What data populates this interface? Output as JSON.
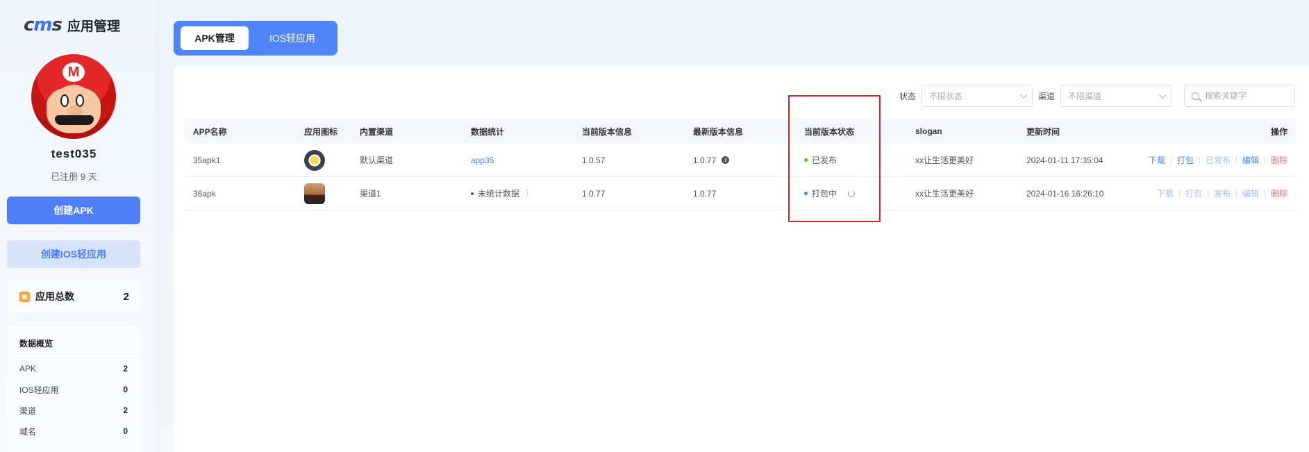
{
  "brand": {
    "logo": "cms",
    "title": "应用管理"
  },
  "user": {
    "name": "test035",
    "registered": "已注册 9 天"
  },
  "sidebar": {
    "create_apk": "创建APK",
    "create_ios": "创建IOS轻应用",
    "total_label": "应用总数",
    "total_value": "2",
    "overview_title": "数据概览",
    "overview": [
      {
        "label": "APK",
        "value": "2"
      },
      {
        "label": "IOS轻应用",
        "value": "0"
      },
      {
        "label": "渠道",
        "value": "2"
      },
      {
        "label": "域名",
        "value": "0"
      }
    ]
  },
  "tabs": [
    {
      "label": "APK管理",
      "active": true
    },
    {
      "label": "IOS轻应用",
      "active": false
    }
  ],
  "filters": {
    "status_label": "状态",
    "status_placeholder": "不限状态",
    "channel_label": "渠道",
    "channel_placeholder": "不限渠道",
    "search_placeholder": "搜索关键字"
  },
  "table": {
    "headers": [
      "APP名称",
      "应用图标",
      "内置渠道",
      "数据统计",
      "当前版本信息",
      "最新版本信息",
      "当前版本状态",
      "slogan",
      "更新时间",
      "操作"
    ],
    "rows": [
      {
        "name": "35apk1",
        "icon": "app-icon-yellow-circle",
        "channel": "默认渠道",
        "stat": "app35",
        "current_version": "1.0.57",
        "latest_version": "1.0.77",
        "status": "已发布",
        "status_color": "#52c41a",
        "slogan": "xx让生活更美好",
        "updated": "2024-01-11 17:35:04",
        "ops": [
          "下载",
          "打包",
          "已发布",
          "编辑",
          "删除"
        ]
      },
      {
        "name": "36apk",
        "icon": "app-icon-sunset-photo",
        "channel": "渠道1",
        "stat": "未统计数据",
        "current_version": "1.0.77",
        "latest_version": "1.0.77",
        "status": "打包中",
        "status_color": "#4f7ff7",
        "slogan": "xx让生活更美好",
        "updated": "2024-01-16 16:26:10",
        "ops": [
          "下载",
          "打包",
          "发布",
          "编辑",
          "删除"
        ]
      }
    ]
  },
  "colors": {
    "primary": "#4f7ff7",
    "danger": "#f56c6c",
    "highlight": "#d9252c"
  }
}
